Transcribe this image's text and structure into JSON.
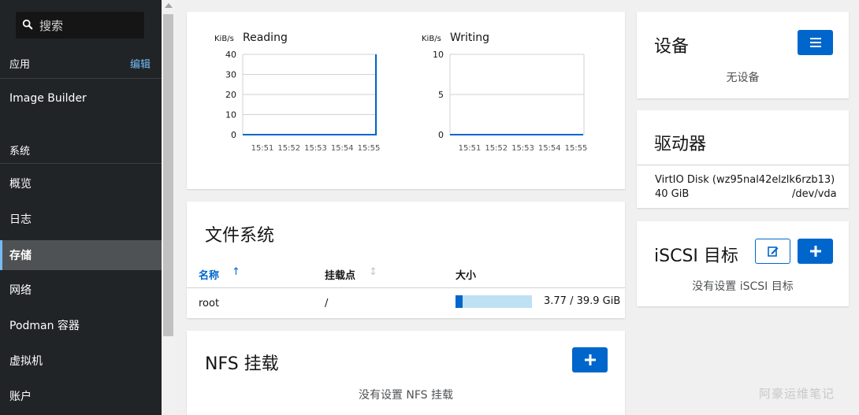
{
  "sidebar": {
    "search_placeholder": "搜索",
    "apps_label": "应用",
    "edit_label": "编辑",
    "image_builder": "Image Builder",
    "system_label": "系统",
    "items": [
      {
        "label": "概览"
      },
      {
        "label": "日志"
      },
      {
        "label": "存储"
      },
      {
        "label": "网络"
      },
      {
        "label": "Podman 容器"
      },
      {
        "label": "虚拟机"
      },
      {
        "label": "账户"
      }
    ],
    "active_item": "存储"
  },
  "chart_data": [
    {
      "type": "line",
      "title": "Reading",
      "ylabel": "KiB/s",
      "x": [
        "15:51",
        "15:52",
        "15:53",
        "15:54",
        "15:55"
      ],
      "yticks": [
        0,
        10,
        20,
        30,
        40
      ],
      "ylim": [
        0,
        40
      ],
      "series": [
        {
          "values": [
            0,
            0,
            0,
            0,
            0,
            40
          ]
        }
      ],
      "grid": true
    },
    {
      "type": "line",
      "title": "Writing",
      "ylabel": "KiB/s",
      "x": [
        "15:51",
        "15:52",
        "15:53",
        "15:54",
        "15:55"
      ],
      "yticks": [
        0,
        5,
        10
      ],
      "ylim": [
        0,
        10
      ],
      "series": [
        {
          "values": [
            0,
            0,
            0,
            0,
            0,
            0
          ]
        }
      ],
      "grid": true
    }
  ],
  "filesystems": {
    "title": "文件系统",
    "columns": [
      "名称",
      "挂载点",
      "大小"
    ],
    "rows": [
      {
        "name": "root",
        "mount": "/",
        "size": "3.77 / 39.9 GiB",
        "usage_fraction": 0.094
      }
    ]
  },
  "nfs": {
    "title": "NFS 挂载",
    "empty": "没有设置 NFS 挂载"
  },
  "devices": {
    "title": "设备",
    "empty": "无设备"
  },
  "drives": {
    "title": "驱动器",
    "items": [
      {
        "name": "VirtIO Disk (wz95nal42elzlk6rzb13)",
        "size": "40 GiB",
        "path": "/dev/vda"
      }
    ]
  },
  "iscsi": {
    "title": "iSCSI 目标",
    "empty": "没有设置 iSCSI 目标"
  },
  "watermark": "阿豪运维笔记",
  "colors": {
    "accent": "#0066cc",
    "sidebar_bg": "#212427",
    "link": "#73bcf7"
  }
}
